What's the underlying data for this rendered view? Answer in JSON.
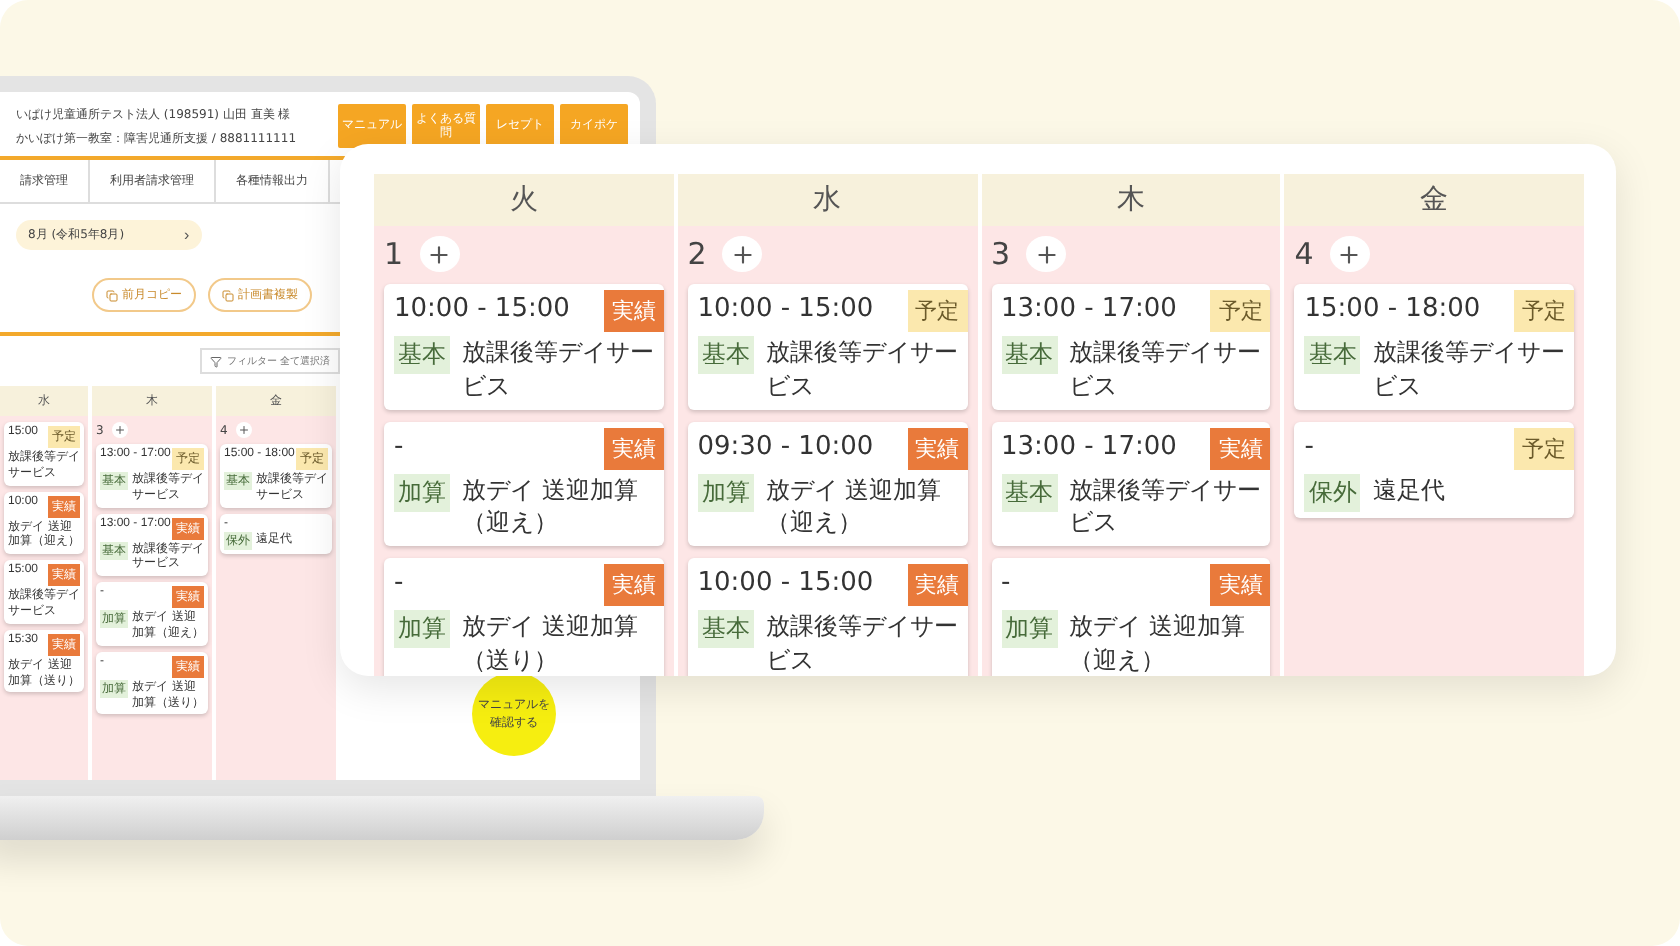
{
  "laptop_screen": {
    "header": {
      "lines": [
        "いぱけ児童通所テスト法人 (198591) 山田 直美 様",
        "かいぽけ第一教室：障害児通所支援 / 8881111111"
      ],
      "buttons": [
        "マニュアル",
        "よくある質問",
        "レセプト",
        "カイポケ"
      ]
    },
    "nav": [
      "請求管理",
      "利用者請求管理",
      "各種情報出力"
    ],
    "month": "8月 (令和5年8月)",
    "next": "›",
    "actions": [
      "前月コピー",
      "計画書複製"
    ],
    "filter": "フィルター 全て選択済",
    "calendar": {
      "columns": [
        {
          "weekday": "水",
          "entries": [
            {
              "time": "15:00",
              "status": "予定",
              "kind": "planned",
              "service": "放課後等デイサービス"
            },
            {
              "time": "10:00",
              "status": "実績",
              "kind": "actual",
              "service": "放デイ 送迎加算（迎え）"
            },
            {
              "time": "15:00",
              "status": "実績",
              "kind": "actual",
              "service": "放課後等デイサービス"
            },
            {
              "time": "15:30",
              "status": "実績",
              "kind": "actual",
              "service": "放デイ 送迎加算（送り）"
            }
          ]
        },
        {
          "weekday": "木",
          "date": "3",
          "entries": [
            {
              "time": "13:00 - 17:00",
              "status": "予定",
              "kind": "planned",
              "category": "基本",
              "service": "放課後等デイサービス"
            },
            {
              "time": "13:00 - 17:00",
              "status": "実績",
              "kind": "actual",
              "category": "基本",
              "service": "放課後等デイサービス"
            },
            {
              "time": "-",
              "status": "実績",
              "kind": "actual",
              "category": "加算",
              "service": "放デイ 送迎加算（迎え）"
            },
            {
              "time": "-",
              "status": "実績",
              "kind": "actual",
              "category": "加算",
              "service": "放デイ 送迎加算（送り）"
            }
          ]
        },
        {
          "weekday": "金",
          "date": "4",
          "entries": [
            {
              "time": "15:00 - 18:00",
              "status": "予定",
              "kind": "planned",
              "category": "基本",
              "service": "放課後等デイサービス"
            },
            {
              "time": "-",
              "category": "保外",
              "service": "遠足代"
            }
          ]
        }
      ]
    },
    "manual_badge": "マニュアルを確認する"
  },
  "zoom_panel": {
    "columns": [
      {
        "weekday": "火",
        "date": "1",
        "entries": [
          {
            "time": "10:00 - 15:00",
            "status": "実績",
            "kind": "actual",
            "category": "基本",
            "service": "放課後等デイサービス"
          },
          {
            "time": "-",
            "status": "実績",
            "kind": "actual",
            "category": "加算",
            "service": "放デイ 送迎加算（迎え）"
          },
          {
            "time": "-",
            "status": "実績",
            "kind": "actual",
            "category": "加算",
            "service": "放デイ 送迎加算（送り）"
          }
        ]
      },
      {
        "weekday": "水",
        "date": "2",
        "entries": [
          {
            "time": "10:00 - 15:00",
            "status": "予定",
            "kind": "planned",
            "category": "基本",
            "service": "放課後等デイサービス"
          },
          {
            "time": "09:30 - 10:00",
            "status": "実績",
            "kind": "actual",
            "category": "加算",
            "service": "放デイ 送迎加算（迎え）"
          },
          {
            "time": "10:00 - 15:00",
            "status": "実績",
            "kind": "actual",
            "category": "基本",
            "service": "放課後等デイサービス"
          }
        ]
      },
      {
        "weekday": "木",
        "date": "3",
        "entries": [
          {
            "time": "13:00 - 17:00",
            "status": "予定",
            "kind": "planned",
            "category": "基本",
            "service": "放課後等デイサービス"
          },
          {
            "time": "13:00 - 17:00",
            "status": "実績",
            "kind": "actual",
            "category": "基本",
            "service": "放課後等デイサービス"
          },
          {
            "time": "-",
            "status": "実績",
            "kind": "actual",
            "category": "加算",
            "service": "放デイ 送迎加算（迎え）"
          }
        ]
      },
      {
        "weekday": "金",
        "date": "4",
        "entries": [
          {
            "time": "15:00 - 18:00",
            "status": "予定",
            "kind": "planned",
            "category": "基本",
            "service": "放課後等デイサービス"
          },
          {
            "time": "-",
            "status": "予定",
            "kind": "planned",
            "category": "保外",
            "service": "遠足代"
          }
        ]
      }
    ]
  }
}
